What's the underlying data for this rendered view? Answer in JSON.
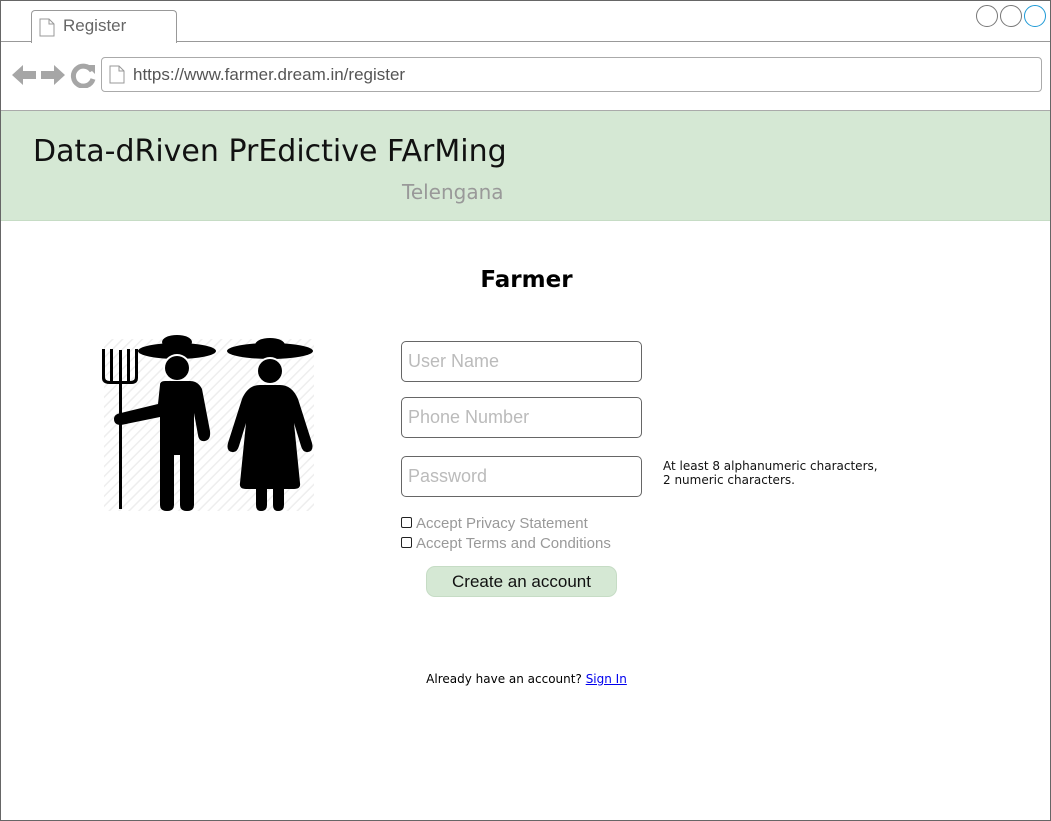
{
  "browser": {
    "tab_title": "Register",
    "url": "https://www.farmer.dream.in/register",
    "icons": {
      "back": "arrow-left-icon",
      "forward": "arrow-right-icon",
      "reload": "reload-icon",
      "page": "page-icon"
    },
    "accent_color": "#1e9ad6"
  },
  "header": {
    "title": "Data-dRiven PrEdictive FArMing",
    "subtitle": "Telengana",
    "background_color": "#d5e8d4"
  },
  "page": {
    "heading": "Farmer",
    "illustration_icon": "farmer-couple-icon"
  },
  "form": {
    "username_placeholder": "User Name",
    "phone_placeholder": "Phone Number",
    "password_placeholder": "Password",
    "password_hint_line1": "At least 8 alphanumeric characters,",
    "password_hint_line2": "2 numeric characters.",
    "privacy_label": "Accept Privacy Statement",
    "terms_label": "Accept Terms and Conditions",
    "submit_label": "Create an account"
  },
  "footer": {
    "prompt": "Already have an account?",
    "signin_label": "Sign In"
  }
}
